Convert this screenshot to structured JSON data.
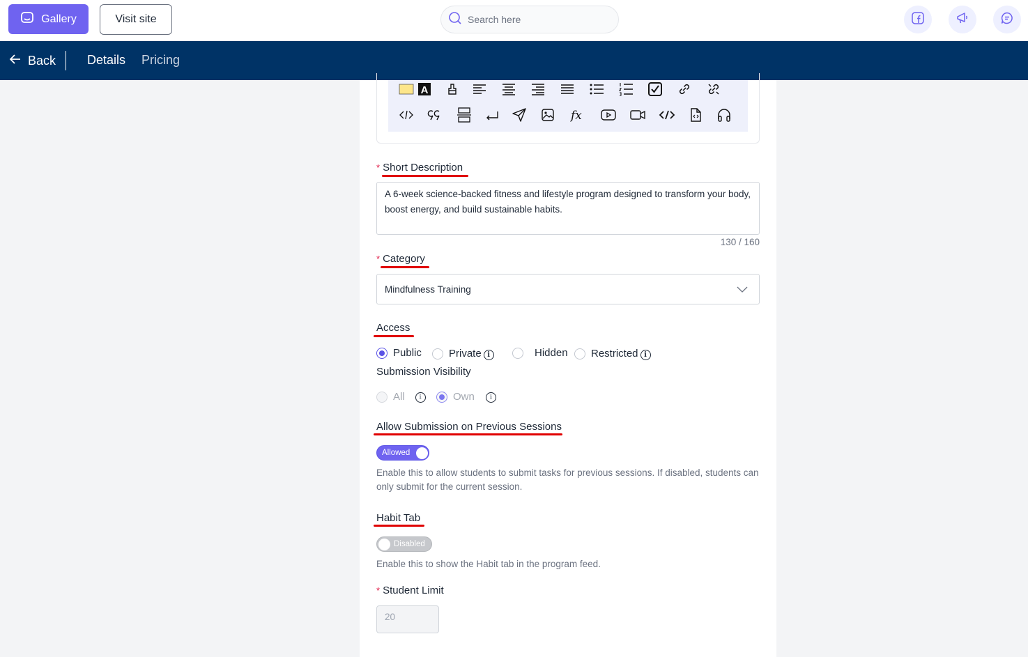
{
  "topbar": {
    "gallery_label": "Gallery",
    "visit_site_label": "Visit site",
    "search_placeholder": "Search here"
  },
  "navbar": {
    "back_label": "Back",
    "tabs": [
      "Details",
      "Pricing"
    ],
    "active_tab": "Details"
  },
  "colors": {
    "brand": "#6f63f0",
    "nav_background": "#003366",
    "required_marker": "#e11d48",
    "annotation_underline": "#e00000"
  },
  "form": {
    "short_description": {
      "label": "Short Description",
      "value": "A 6-week science-backed fitness and lifestyle program designed to transform your body, boost energy, and build sustainable habits.",
      "counter": "130 / 160"
    },
    "category": {
      "label": "Category",
      "value": "Mindfulness Training"
    },
    "access": {
      "label": "Access",
      "options": [
        "Public",
        "Private",
        "Hidden",
        "Restricted"
      ],
      "selected": "Public"
    },
    "submission_visibility": {
      "label": "Submission Visibility",
      "options": [
        "All",
        "Own"
      ],
      "selected": "Own"
    },
    "allow_previous": {
      "label": "Allow Submission on Previous Sessions",
      "toggle_text": "Allowed",
      "help": "Enable this to allow students to submit tasks for previous sessions. If disabled, students can only submit for the current session."
    },
    "habit_tab": {
      "label": "Habit Tab",
      "toggle_text": "Disabled",
      "help": "Enable this to show the Habit tab in the program feed."
    },
    "student_limit": {
      "label": "Student Limit",
      "placeholder": "20"
    }
  },
  "editor_toolbar": {
    "row1": [
      "highlight-color-icon",
      "font-color-icon",
      "clear-format-icon",
      "align-left-icon",
      "align-center-icon",
      "align-right-icon",
      "align-justify-icon",
      "bullet-list-icon",
      "numbered-list-icon",
      "checklist-icon",
      "link-icon",
      "unlink-icon"
    ],
    "row2": [
      "code-icon",
      "blockquote-icon",
      "page-break-icon",
      "line-break-icon",
      "send-icon",
      "image-icon",
      "formula-icon",
      "youtube-icon",
      "video-icon",
      "embed-code-icon",
      "file-code-icon",
      "audio-icon"
    ]
  }
}
